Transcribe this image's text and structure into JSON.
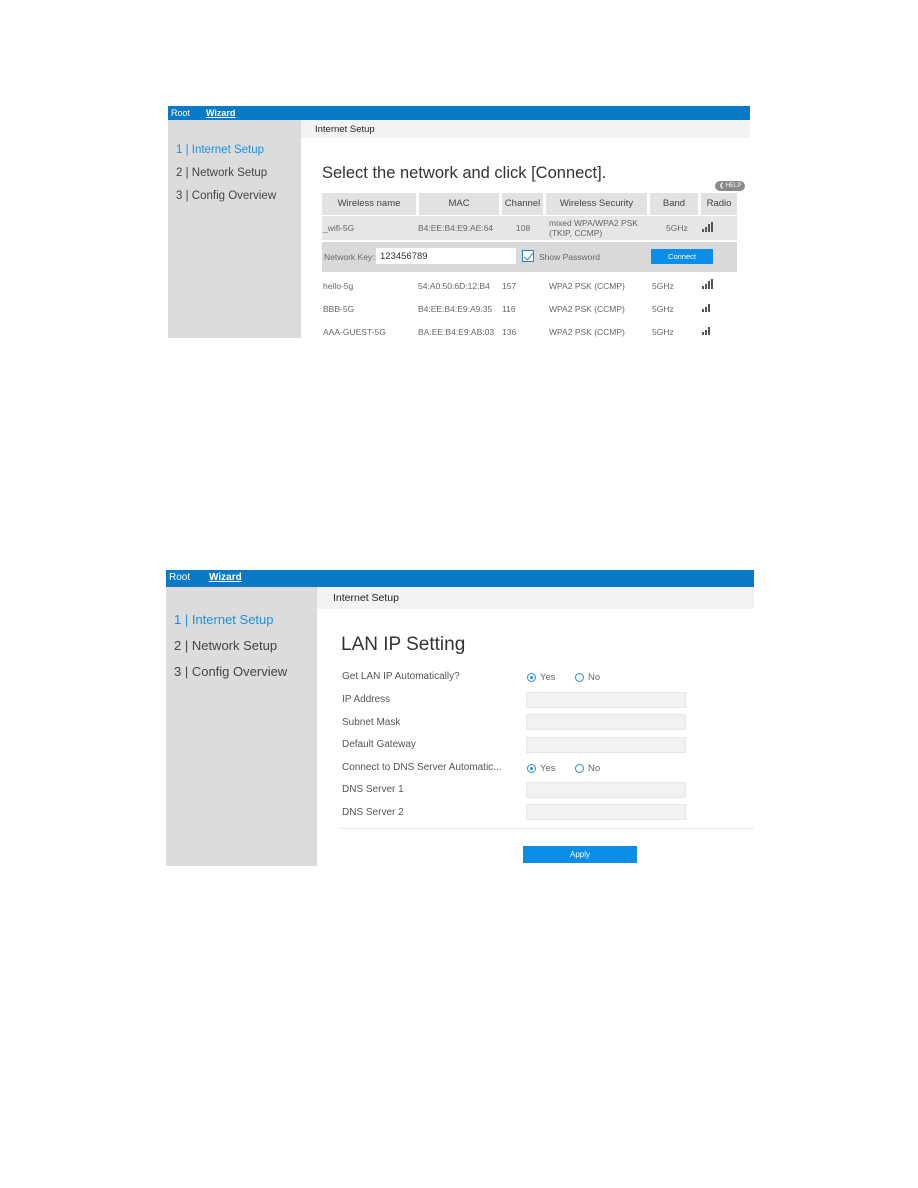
{
  "screenshot1": {
    "topbar": {
      "root": "Root",
      "wizard": "Wizard"
    },
    "breadcrumb": "Internet Setup",
    "sidebar": [
      {
        "label": "1 | Internet Setup",
        "active": true
      },
      {
        "label": "2 | Network Setup",
        "active": false
      },
      {
        "label": "3 | Config Overview",
        "active": false
      }
    ],
    "heading": "Select the network and click [Connect].",
    "help_label": "HELP",
    "columns": [
      "Wireless name",
      "MAC",
      "Channel",
      "Wireless Security",
      "Band",
      "Radio"
    ],
    "selected_network": {
      "name": "_wifi-5G",
      "mac": "B4:EE:B4:E9:AE:64",
      "channel": "108",
      "security_line1": "mixed WPA/WPA2 PSK",
      "security_line2": "(TKIP, CCMP)",
      "band": "5GHz",
      "signal_bars": 4
    },
    "network_key": {
      "label": "Network Key:",
      "value": "123456789",
      "show_password_label": "Show Password",
      "show_password_checked": true,
      "connect_label": "Connect"
    },
    "networks": [
      {
        "name": "hello-5g",
        "mac": "54:A0:50:6D:12:B4",
        "channel": "157",
        "security": "WPA2 PSK (CCMP)",
        "band": "5GHz",
        "signal_bars": 4
      },
      {
        "name": "BBB-5G",
        "mac": "B4:EE:B4:E9:A9:35",
        "channel": "116",
        "security": "WPA2 PSK (CCMP)",
        "band": "5GHz",
        "signal_bars": 3
      },
      {
        "name": "AAA-GUEST-5G",
        "mac": "BA:EE:B4:E9:AB:03",
        "channel": "136",
        "security": "WPA2 PSK (CCMP)",
        "band": "5GHz",
        "signal_bars": 3
      }
    ]
  },
  "screenshot2": {
    "topbar": {
      "root": "Root",
      "wizard": "Wizard"
    },
    "breadcrumb": "Internet Setup",
    "sidebar": [
      {
        "label": "1 | Internet Setup",
        "active": true
      },
      {
        "label": "2 | Network Setup",
        "active": false
      },
      {
        "label": "3 | Config Overview",
        "active": false
      }
    ],
    "heading": "LAN IP Setting",
    "fields": {
      "get_lan_ip_auto": {
        "label": "Get LAN IP Automatically?",
        "yes": "Yes",
        "no": "No",
        "selected": "Yes"
      },
      "ip_address": {
        "label": "IP Address",
        "value": ""
      },
      "subnet_mask": {
        "label": "Subnet Mask",
        "value": ""
      },
      "default_gateway": {
        "label": "Default Gateway",
        "value": ""
      },
      "dns_auto": {
        "label": "Connect to DNS Server Automatic...",
        "yes": "Yes",
        "no": "No",
        "selected": "Yes"
      },
      "dns_server_1": {
        "label": "DNS Server 1",
        "value": ""
      },
      "dns_server_2": {
        "label": "DNS Server 2",
        "value": ""
      }
    },
    "apply_label": "Apply"
  }
}
